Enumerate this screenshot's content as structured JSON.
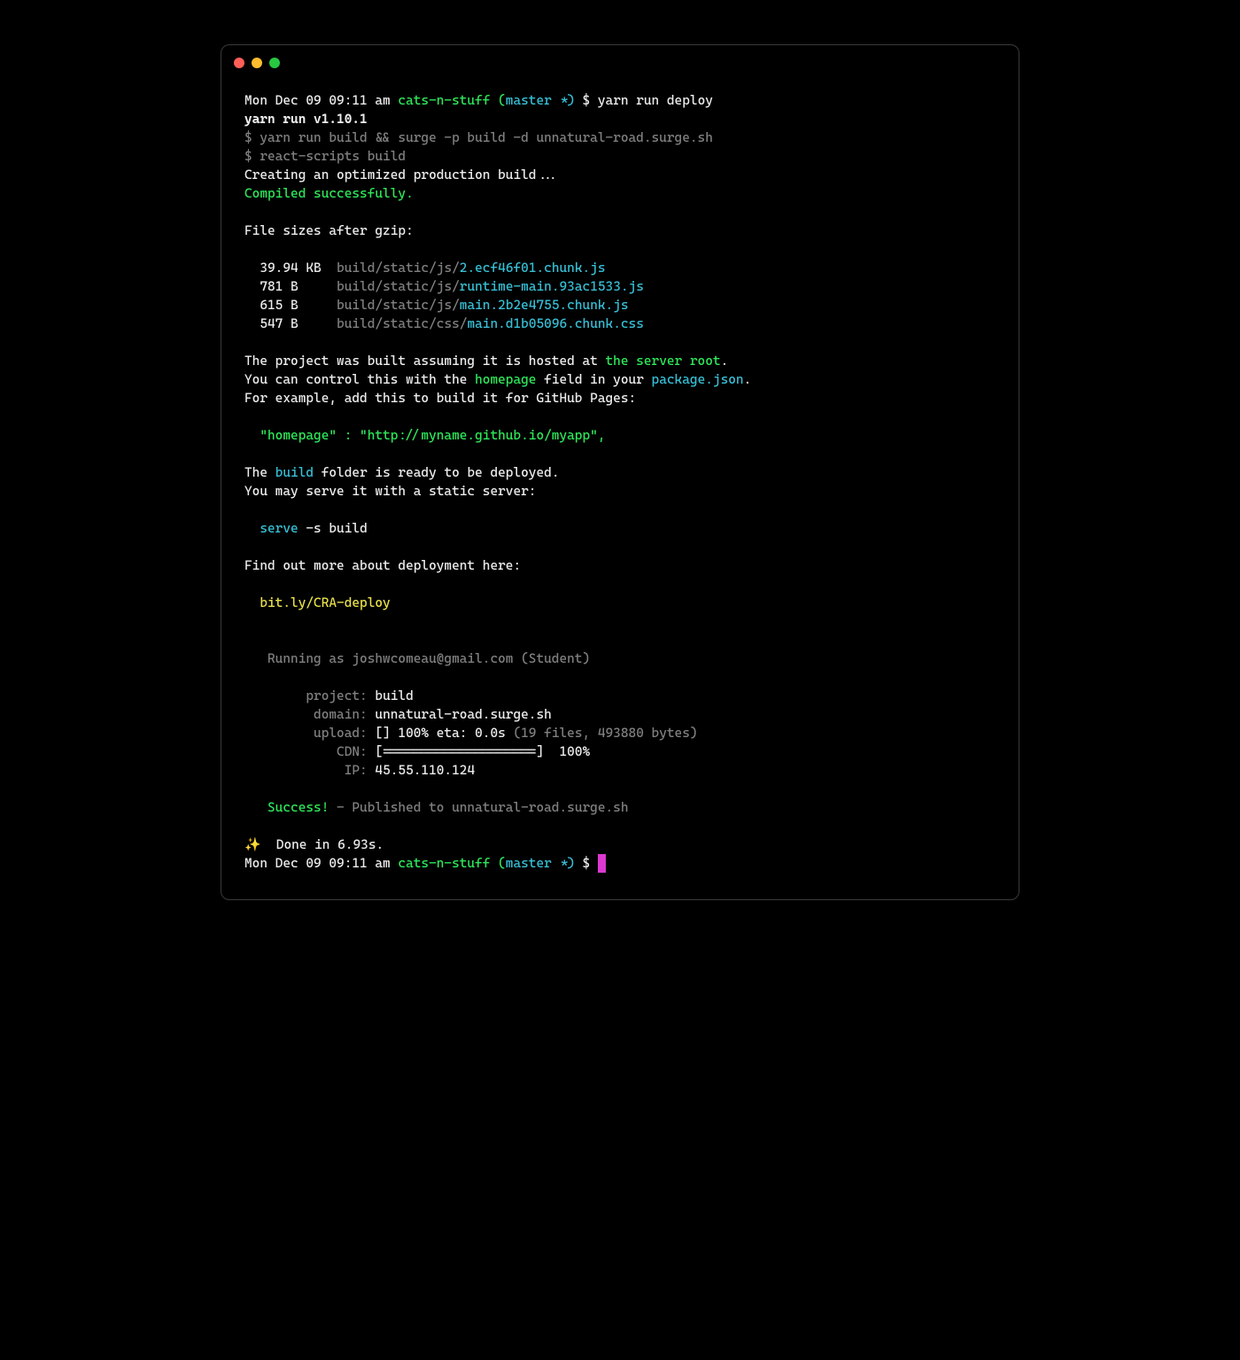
{
  "prompt": {
    "datetime": "Mon Dec 09 09:11 am",
    "project": "cats-n-stuff",
    "branch_open": "(",
    "branch": "master *",
    "branch_close": ")",
    "symbol": " $ ",
    "command": "yarn run deploy"
  },
  "yarn_version": "yarn run v1.10.1",
  "line_build_cmd": "$ yarn run build && surge -p build -d unnatural-road.surge.sh",
  "line_rs": "$ react-scripts build",
  "creating": "Creating an optimized production build...",
  "compiled": "Compiled successfully.",
  "file_sizes_header": "File sizes after gzip:",
  "files": [
    {
      "size": "39.94 KB",
      "path_prefix": "build/static/js/",
      "path_file": "2.ecf46f01.chunk.js"
    },
    {
      "size": "781 B",
      "path_prefix": "build/static/js/",
      "path_file": "runtime-main.93ac1533.js"
    },
    {
      "size": "615 B",
      "path_prefix": "build/static/js/",
      "path_file": "main.2b2e4755.chunk.js"
    },
    {
      "size": "547 B",
      "path_prefix": "build/static/css/",
      "path_file": "main.d1b05096.chunk.css"
    }
  ],
  "hosted_pre": "The project was built assuming it is hosted at ",
  "hosted_highlight": "the server root",
  "hosted_post": ".",
  "control_pre": "You can control this with the ",
  "control_hp": "homepage",
  "control_mid": " field in your ",
  "control_pkg": "package.json",
  "control_post": ".",
  "ghpages": "For example, add this to build it for GitHub Pages:",
  "hp_hint": "  \"homepage\" : \"http://myname.github.io/myapp\",",
  "build_ready_pre": "The ",
  "build_ready_b": "build",
  "build_ready_post": " folder is ready to be deployed.",
  "serve_msg": "You may serve it with a static server:",
  "serve_cmd_cmd": "serve",
  "serve_cmd_args": " -s build",
  "find_out": "Find out more about deployment here:",
  "deploy_link": "  bit.ly/CRA-deploy",
  "running_as": "   Running as joshwcomeau@gmail.com (Student)",
  "surge": {
    "project_k": "        project:",
    "project_v": " build",
    "domain_k": "         domain:",
    "domain_v": " unnatural-road.surge.sh",
    "upload_k": "         upload:",
    "upload_v": " [] 100% eta: 0.0s",
    "upload_meta": " (19 files, 493880 bytes)",
    "cdn_k": "            CDN:",
    "cdn_v": " [====================]  100%",
    "ip_k": "             IP:",
    "ip_v": " 45.55.110.124"
  },
  "success_label": "   Success!",
  "success_rest": " - Published to unnatural-road.surge.sh",
  "done_sparkle": "✨ ",
  "done": " Done in 6.93s.",
  "prompt2": {
    "datetime": "Mon Dec 09 09:11 am",
    "project": "cats-n-stuff",
    "branch_open": "(",
    "branch": "master *",
    "branch_close": ")",
    "symbol": " $ "
  }
}
